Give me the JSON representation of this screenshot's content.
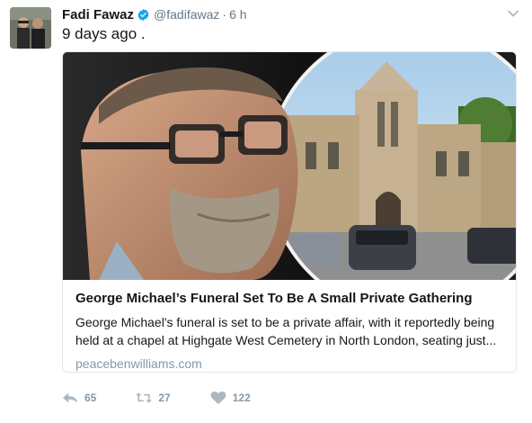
{
  "tweet": {
    "author": {
      "display_name": "Fadi Fawaz",
      "screen_name": "@fadifawaz",
      "verified": true,
      "avatar_icon": "profile-photo"
    },
    "separator": "·",
    "time": "6 h",
    "text": "9 days ago .",
    "card": {
      "image_icon": "george-michael-and-highgate-chapel-photo",
      "title": "George Michael’s Funeral Set To Be A Small Private Gathering",
      "description": "George Michael's funeral is set to be a private affair, with it reportedly being held at a chapel at Highgate West Cemetery in North London, seating just...",
      "domain": "peacebenwilliams.com"
    },
    "actions": {
      "reply": {
        "icon": "reply-icon",
        "count": "65"
      },
      "retweet": {
        "icon": "retweet-icon",
        "count": "27"
      },
      "like": {
        "icon": "heart-icon",
        "count": "122"
      }
    },
    "colors": {
      "verified": "#1da1f2",
      "muted": "#657786",
      "action": "#8899a6",
      "border": "#e1e8ed"
    }
  }
}
